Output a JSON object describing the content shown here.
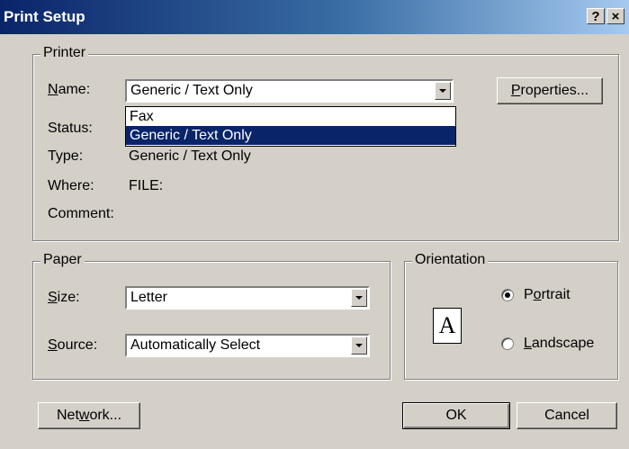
{
  "window": {
    "title": "Print Setup",
    "help_glyph": "?",
    "close_glyph": "×"
  },
  "printer": {
    "legend": "Printer",
    "name_label": "Name:",
    "name_value": "Generic / Text Only",
    "status_label": "Status:",
    "type_label": "Type:",
    "type_value": "Generic / Text Only",
    "where_label": "Where:",
    "where_value": "FILE:",
    "comment_label": "Comment:",
    "properties_label": "Properties...",
    "dropdown_options": [
      "Fax",
      "Generic / Text Only"
    ],
    "selected_option": "Generic / Text Only"
  },
  "paper": {
    "legend": "Paper",
    "size_label": "Size:",
    "size_value": "Letter",
    "source_label": "Source:",
    "source_value": "Automatically Select"
  },
  "orientation": {
    "legend": "Orientation",
    "portrait_label": "Portrait",
    "landscape_label": "Landscape",
    "selected": "Portrait",
    "page_glyph": "A"
  },
  "buttons": {
    "network": "Network...",
    "ok": "OK",
    "cancel": "Cancel"
  }
}
